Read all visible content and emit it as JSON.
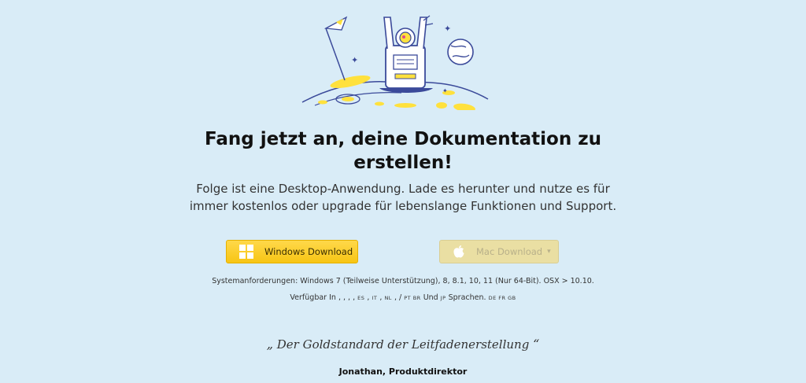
{
  "hero": {
    "headline_line1": "Fang jetzt an, deine Dokumentation zu",
    "headline_line2": "erstellen!",
    "sub_line1": "Folge ist eine Desktop-Anwendung. Lade es herunter und nutze es für",
    "sub_line2": "immer kostenlos oder upgrade für lebenslange Funktionen und Support."
  },
  "downloads": {
    "windows_label": "Windows Download",
    "mac_label": "Mac Download",
    "mac_caret": "▾"
  },
  "requirements": {
    "text": "Systemanforderungen: Windows 7 (Teilweise Unterstützung), 8, 8.1, 10, 11 (Nur 64-Bit). OSX > 10.10."
  },
  "languages": {
    "prefix": "Verfügbar In , , , ,",
    "es": "ES",
    "sep1": ",",
    "it": "IT",
    "sep2": ",",
    "nl": "NL",
    "sep3": ", /",
    "pt_br": "PT BR",
    "und": "Und",
    "jp": "JP",
    "sprachen": "Sprachen.",
    "de_fr_gb": "DE FR GB"
  },
  "testimonial": {
    "open_mark": "„",
    "quote": "Der Goldstandard der Leitfadenerstellung",
    "close_mark": "“",
    "author": "Jonathan, Produktdirektor"
  },
  "colors": {
    "background": "#d9ecf7",
    "primary_button": "#f7c514",
    "disabled_button": "#eadfa3",
    "illustration_stroke": "#3b4a9a",
    "illustration_accent": "#ffe13d"
  }
}
